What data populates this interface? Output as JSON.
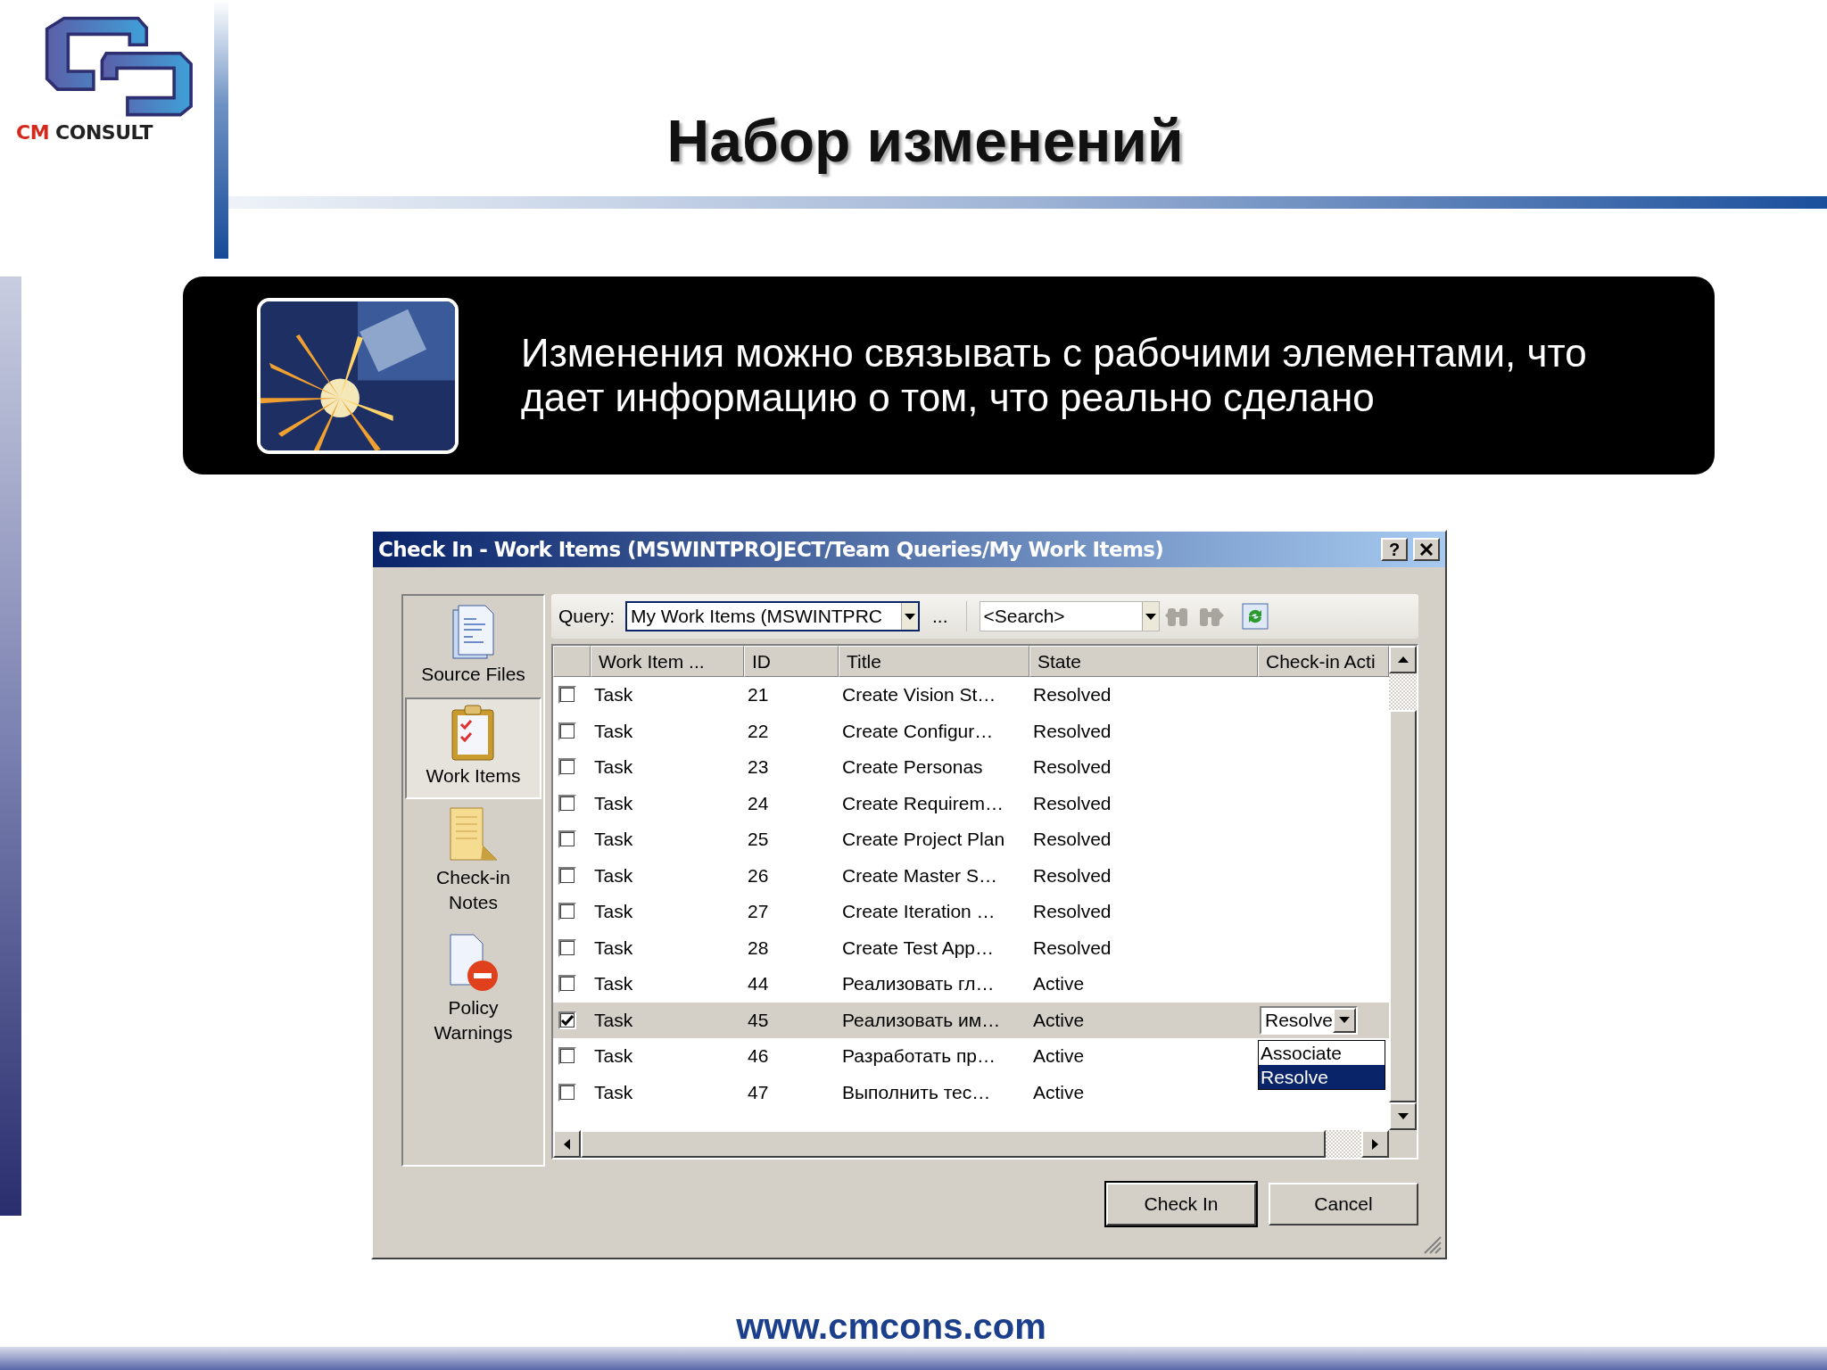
{
  "logo": {
    "part_1": "CM",
    "part_2": "CONSULT"
  },
  "slide_title": "Набор изменений",
  "banner": {
    "text": "Изменения можно связывать с рабочими элементами, что дает информацию о том, что реально сделано"
  },
  "dialog": {
    "title": "Check In - Work Items (MSWINTPROJECT/Team Queries/My Work Items)",
    "help": "?",
    "sidebar": [
      {
        "kind": "files",
        "label": "Source Files",
        "selected": false
      },
      {
        "kind": "clipboard",
        "label": "Work Items",
        "selected": true
      },
      {
        "kind": "notes",
        "label": "Check-in Notes",
        "selected": false
      },
      {
        "kind": "warning",
        "label": "Policy Warnings",
        "selected": false
      }
    ],
    "query": {
      "label": "Query:",
      "value": "My Work Items (MSWINTPRC",
      "more": "..."
    },
    "search": {
      "value": "<Search>"
    },
    "table": {
      "columns": [
        "Work Item ...",
        "ID",
        "Title",
        "State",
        "Check-in Acti"
      ],
      "rows": [
        {
          "checked": false,
          "selected": false,
          "type": "Task",
          "id": "21",
          "title": "Create Vision St…",
          "state": "Resolved"
        },
        {
          "checked": false,
          "selected": false,
          "type": "Task",
          "id": "22",
          "title": "Create Configur…",
          "state": "Resolved"
        },
        {
          "checked": false,
          "selected": false,
          "type": "Task",
          "id": "23",
          "title": "Create Personas",
          "state": "Resolved"
        },
        {
          "checked": false,
          "selected": false,
          "type": "Task",
          "id": "24",
          "title": "Create Requirem…",
          "state": "Resolved"
        },
        {
          "checked": false,
          "selected": false,
          "type": "Task",
          "id": "25",
          "title": "Create Project Plan",
          "state": "Resolved"
        },
        {
          "checked": false,
          "selected": false,
          "type": "Task",
          "id": "26",
          "title": "Create Master S…",
          "state": "Resolved"
        },
        {
          "checked": false,
          "selected": false,
          "type": "Task",
          "id": "27",
          "title": "Create Iteration …",
          "state": "Resolved"
        },
        {
          "checked": false,
          "selected": false,
          "type": "Task",
          "id": "28",
          "title": "Create Test App…",
          "state": "Resolved"
        },
        {
          "checked": false,
          "selected": false,
          "type": "Task",
          "id": "44",
          "title": "Реализовать гл…",
          "state": "Active"
        },
        {
          "checked": true,
          "selected": true,
          "type": "Task",
          "id": "45",
          "title": "Реализовать им…",
          "state": "Active",
          "action": "Resolve"
        },
        {
          "checked": false,
          "selected": false,
          "type": "Task",
          "id": "46",
          "title": "Разработать пр…",
          "state": "Active"
        },
        {
          "checked": false,
          "selected": false,
          "type": "Task",
          "id": "47",
          "title": "Выполнить тес…",
          "state": "Active"
        }
      ]
    },
    "action_dropdown": [
      {
        "label": "Associate",
        "selected": false
      },
      {
        "label": "Resolve",
        "selected": true
      }
    ],
    "buttons": [
      {
        "label": "Check In",
        "default": true
      },
      {
        "label": "Cancel",
        "default": false
      }
    ]
  },
  "footer": "www.cmcons.com"
}
